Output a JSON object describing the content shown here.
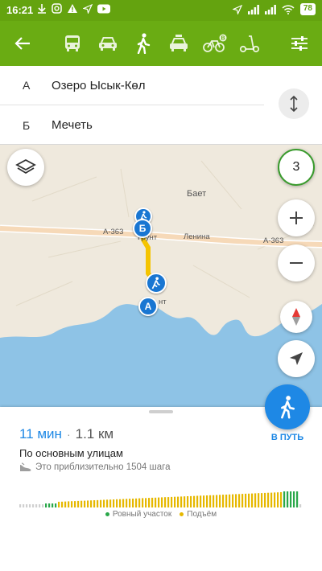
{
  "status_bar": {
    "time": "16:21",
    "battery": "78",
    "left_icons": [
      "download-icon",
      "instagram-icon",
      "alert-icon",
      "nav-arrow-icon",
      "youtube-icon"
    ],
    "right_icons": [
      "location-icon",
      "signal-icon",
      "signal-icon",
      "wifi-icon",
      "battery-icon"
    ]
  },
  "toolbar": {
    "background": "#6aac13",
    "modes": [
      "bus-icon",
      "car-icon",
      "walk-icon",
      "taxi-icon",
      "bike-icon",
      "scooter-icon"
    ],
    "selected_mode": "walk-icon"
  },
  "route": {
    "from": {
      "letter": "А",
      "name": "Озеро Ысык-Көл"
    },
    "to": {
      "letter": "Б",
      "name": "Мечеть"
    }
  },
  "map": {
    "village_label": "Бает",
    "road_label_1": "А-363",
    "road_label_2": "Ленина",
    "road_label_3": "А-363",
    "place_label_1": "Грунт",
    "place_label_2": "нт",
    "pin_a": "А",
    "pin_b": "Б",
    "layers_count": "3",
    "water_color": "#8ec3e6",
    "route_color": "#f5c400"
  },
  "summary": {
    "duration": "11 мин",
    "separator": "·",
    "distance": "1.1 км",
    "route_type": "По основным улицам",
    "steps_text": "Это приблизительно 1504 шага"
  },
  "go_button": {
    "label": "В ПУТЬ"
  },
  "elevation": {
    "flat_color": "#2aa84a",
    "uphill_color": "#e6b800",
    "legend_flat": "Ровный участок",
    "legend_uphill": "Подъём"
  }
}
